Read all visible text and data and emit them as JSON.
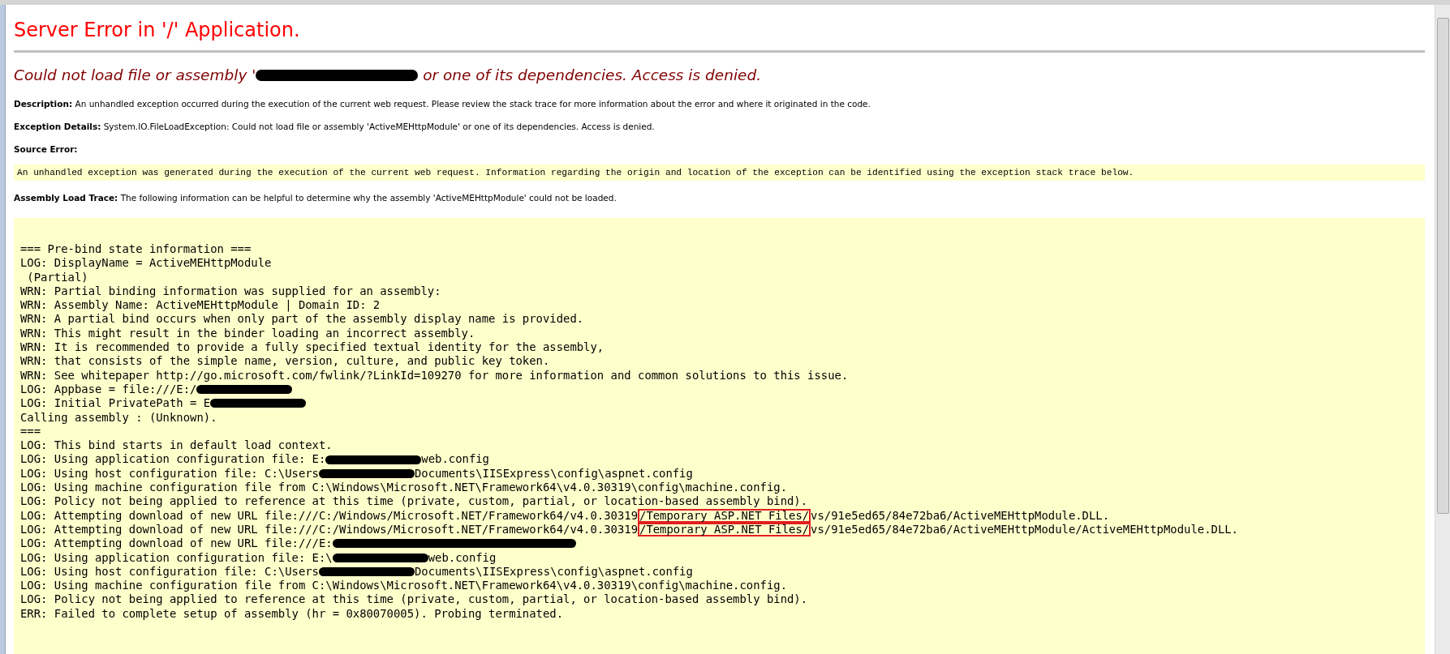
{
  "title": "Server Error in '/' Application.",
  "heading": {
    "before": "Could not load file or assembly '",
    "after": " or one of its dependencies. Access is denied."
  },
  "details": [
    {
      "label": "Description:",
      "text": "An unhandled exception occurred during the execution of the current web request. Please review the stack trace for more information about the error and where it originated in the code."
    },
    {
      "label": "Exception Details:",
      "text": "System.IO.FileLoadException: Could not load file or assembly 'ActiveMEHttpModule' or one of its dependencies. Access is denied."
    },
    {
      "label": "Source Error:"
    }
  ],
  "source_error": "An unhandled exception was generated during the execution of the current web request. Information regarding the origin and location of the exception can be identified using the exception stack trace below.",
  "assembly_trace": {
    "label": "Assembly Load Trace:",
    "text": "The following information can be helpful to determine why the assembly 'ActiveMEHttpModule' could not be loaded."
  },
  "log_lines": [
    [
      {
        "kind": "text",
        "text": "=== Pre-bind state information ==="
      }
    ],
    [
      {
        "kind": "text",
        "text": "LOG: DisplayName = ActiveMEHttpModule"
      }
    ],
    [
      {
        "kind": "text",
        "text": " (Partial)"
      }
    ],
    [
      {
        "kind": "text",
        "text": "WRN: Partial binding information was supplied for an assembly:"
      }
    ],
    [
      {
        "kind": "text",
        "text": "WRN: Assembly Name: ActiveMEHttpModule | Domain ID: 2"
      }
    ],
    [
      {
        "kind": "text",
        "text": "WRN: A partial bind occurs when only part of the assembly display name is provided."
      }
    ],
    [
      {
        "kind": "text",
        "text": "WRN: This might result in the binder loading an incorrect assembly."
      }
    ],
    [
      {
        "kind": "text",
        "text": "WRN: It is recommended to provide a fully specified textual identity for the assembly,"
      }
    ],
    [
      {
        "kind": "text",
        "text": "WRN: that consists of the simple name, version, culture, and public key token."
      }
    ],
    [
      {
        "kind": "text",
        "text": "WRN: See whitepaper http://go.microsoft.com/fwlink/?LinkId=109270 for more information and common solutions to this issue."
      }
    ],
    [
      {
        "kind": "text",
        "text": "LOG: Appbase = file:///E:/"
      },
      {
        "kind": "redaction"
      }
    ],
    [
      {
        "kind": "text",
        "text": "LOG: Initial PrivatePath = E"
      },
      {
        "kind": "redaction"
      }
    ],
    [
      {
        "kind": "text",
        "text": "Calling assembly : (Unknown)."
      }
    ],
    [
      {
        "kind": "text",
        "text": "==="
      }
    ],
    [
      {
        "kind": "text",
        "text": "LOG: This bind starts in default load context."
      }
    ],
    [
      {
        "kind": "text",
        "text": "LOG: Using application configuration file: E:"
      },
      {
        "kind": "redaction"
      },
      {
        "kind": "text",
        "text": "web.config"
      }
    ],
    [
      {
        "kind": "text",
        "text": "LOG: Using host configuration file: C:\\Users"
      },
      {
        "kind": "redaction"
      },
      {
        "kind": "text",
        "text": "Documents\\IISExpress\\config\\aspnet.config"
      }
    ],
    [
      {
        "kind": "text",
        "text": "LOG: Using machine configuration file from C:\\Windows\\Microsoft.NET\\Framework64\\v4.0.30319\\config\\machine.config."
      }
    ],
    [
      {
        "kind": "text",
        "text": "LOG: Policy not being applied to reference at this time (private, custom, partial, or location-based assembly bind)."
      }
    ],
    [
      {
        "kind": "text",
        "text": "LOG: Attempting download of new URL file:///C:/Windows/Microsoft.NET/Framework64/v4.0.30319"
      },
      {
        "kind": "boxed",
        "text": "/Temporary ASP.NET Files/"
      },
      {
        "kind": "text",
        "text": "vs/91e5ed65/84e72ba6/ActiveMEHttpModule.DLL."
      }
    ],
    [
      {
        "kind": "text",
        "text": "LOG: Attempting download of new URL file:///C:/Windows/Microsoft.NET/Framework64/v4.0.30319"
      },
      {
        "kind": "boxed",
        "text": "/Temporary ASP.NET Files/"
      },
      {
        "kind": "text",
        "text": "vs/91e5ed65/84e72ba6/ActiveMEHttpModule/ActiveMEHttpModule.DLL."
      }
    ],
    [
      {
        "kind": "text",
        "text": "LOG: Attempting download of new URL file:///E:"
      },
      {
        "kind": "redaction",
        "wide": true
      }
    ],
    [
      {
        "kind": "text",
        "text": "LOG: Using application configuration file: E:\\"
      },
      {
        "kind": "redaction"
      },
      {
        "kind": "text",
        "text": "web.config"
      }
    ],
    [
      {
        "kind": "text",
        "text": "LOG: Using host configuration file: C:\\Users"
      },
      {
        "kind": "redaction"
      },
      {
        "kind": "text",
        "text": "Documents\\IISExpress\\config\\aspnet.config"
      }
    ],
    [
      {
        "kind": "text",
        "text": "LOG: Using machine configuration file from C:\\Windows\\Microsoft.NET\\Framework64\\v4.0.30319\\config\\machine.config."
      }
    ],
    [
      {
        "kind": "text",
        "text": "LOG: Policy not being applied to reference at this time (private, custom, partial, or location-based assembly bind)."
      }
    ],
    [
      {
        "kind": "text",
        "text": "ERR: Failed to complete setup of assembly (hr = 0x80070005). Probing terminated."
      }
    ]
  ]
}
